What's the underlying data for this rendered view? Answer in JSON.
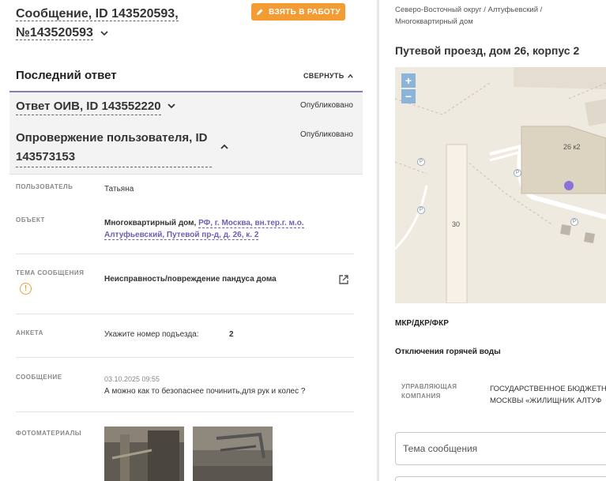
{
  "message": {
    "title_line1": "Сообщение, ID 143520593,",
    "title_line2": "№143520593",
    "take_button": "ВЗЯТЬ В РАБОТУ"
  },
  "last_answer": {
    "heading": "Последний ответ",
    "collapse": "СВЕРНУТЬ",
    "items": [
      {
        "title": "Ответ ОИВ, ID 143552220",
        "status": "Опубликовано"
      },
      {
        "title": "Опровержение пользователя, ID 143573153",
        "status": "Опубликовано"
      }
    ]
  },
  "details": {
    "user_label": "ПОЛЬЗОВАТЕЛЬ",
    "user_value": "Татьяна",
    "object_label": "ОБЪЕКТ",
    "object_type": "Многоквартирный дом,",
    "object_addr1": "РФ, г. Москва, вн.тер.г. м.о.",
    "object_addr2": "Алтуфьевский, Путевой пр-д, д. 26, к. 2",
    "topic_label": "ТЕМА СООБЩЕНИЯ",
    "topic_value": "Неисправность/повреждение пандуса дома",
    "survey_label": "АНКЕТА",
    "survey_question": "Укажите номер подъезда:",
    "survey_answer": "2",
    "message_label": "СООБЩЕНИЕ",
    "message_date": "03.10.2025 09:55",
    "message_text": "А можно как то безопаснее починить,для рук и колес ?",
    "photos_label": "ФОТОМАТЕРИАЛЫ"
  },
  "right": {
    "breadcrumb_line1": "Северо-Восточный округ / Алтуфьевский /",
    "breadcrumb_line2": "Многоквартирный дом",
    "address": "Путевой проезд, дом 26, корпус 2",
    "map": {
      "zoom_in": "+",
      "zoom_out": "−",
      "building_label": "26 к2",
      "road_label": "30",
      "parking": "P"
    },
    "mkr": "МКР/ДКР/ФКР",
    "hot_water": "Отключения горячей воды",
    "uk_label_line1": "УПРАВЛЯЮЩАЯ",
    "uk_label_line2": "КОМПАНИЯ",
    "uk_value_line1": "ГОСУДАРСТВЕННОЕ БЮДЖЕТН",
    "uk_value_line2": "МОСКВЫ «ЖИЛИЩНИК АЛТУФ",
    "topic_placeholder": "Тема сообщения"
  }
}
